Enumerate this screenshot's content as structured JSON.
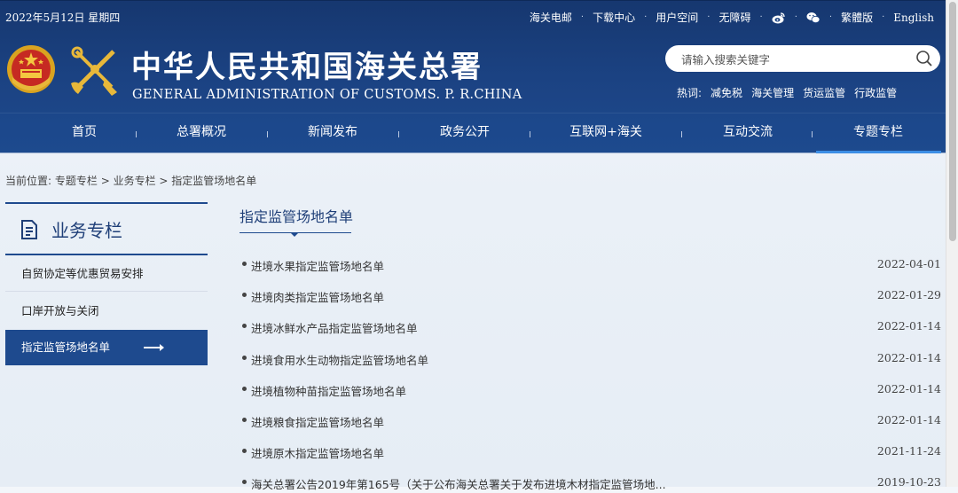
{
  "header": {
    "date": "2022年5月12日 星期四",
    "top_links": [
      "海关电邮",
      "下载中心",
      "用户空间",
      "无障碍",
      "weibo-icon",
      "wechat-icon",
      "繁體版",
      "English"
    ],
    "title_cn": "中华人民共和国海关总署",
    "title_en": "GENERAL ADMINISTRATION OF CUSTOMS. P. R.CHINA",
    "search_placeholder": "请输入搜索关键字",
    "hot_label": "热词:",
    "hot_words": [
      "减免税",
      "海关管理",
      "货运监管",
      "行政监管"
    ]
  },
  "nav": {
    "items": [
      "首页",
      "总署概况",
      "新闻发布",
      "政务公开",
      "互联网+海关",
      "互动交流",
      "专题专栏"
    ],
    "active": "专题专栏"
  },
  "breadcrumb": {
    "label": "当前位置:",
    "path": [
      "专题专栏",
      "业务专栏",
      "指定监管场地名单"
    ],
    "sep": " > "
  },
  "sidebar": {
    "title": "业务专栏",
    "items": [
      "自贸协定等优惠贸易安排",
      "口岸开放与关闭",
      "指定监管场地名单"
    ],
    "active": "指定监管场地名单"
  },
  "main": {
    "title": "指定监管场地名单",
    "list": [
      {
        "title": "进境水果指定监管场地名单",
        "date": "2022-04-01"
      },
      {
        "title": "进境肉类指定监管场地名单",
        "date": "2022-01-29"
      },
      {
        "title": "进境冰鲜水产品指定监管场地名单",
        "date": "2022-01-14"
      },
      {
        "title": "进境食用水生动物指定监管场地名单",
        "date": "2022-01-14"
      },
      {
        "title": "进境植物种苗指定监管场地名单",
        "date": "2022-01-14"
      },
      {
        "title": "进境粮食指定监管场地名单",
        "date": "2022-01-14"
      },
      {
        "title": "进境原木指定监管场地名单",
        "date": "2021-11-24"
      },
      {
        "title": "海关总署公告2019年第165号（关于公布海关总署关于发布进境木材指定监管场地...",
        "date": "2019-10-23"
      }
    ]
  },
  "colors": {
    "header_blue": "#1b4282",
    "nav_active_bar": "#3d8ee5",
    "sidebar_active": "#1e4a8e",
    "title_blue": "#1f3f78"
  }
}
